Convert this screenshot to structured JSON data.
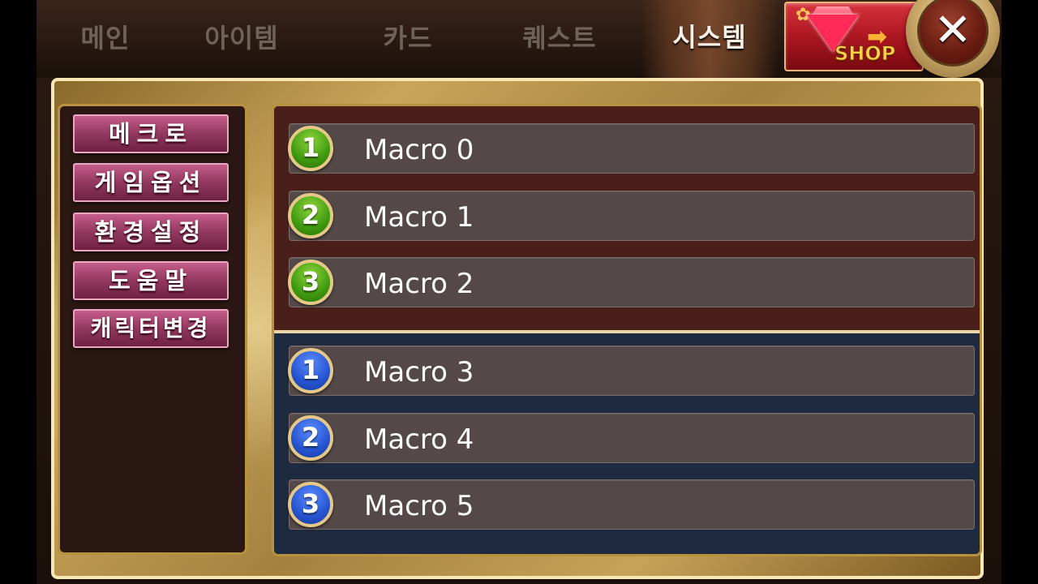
{
  "tabs": [
    {
      "label": "메인",
      "active": false
    },
    {
      "label": "아이템",
      "active": false
    },
    {
      "label": "카드",
      "active": false
    },
    {
      "label": "퀘스트",
      "active": false
    },
    {
      "label": "시스템",
      "active": true
    }
  ],
  "shop": {
    "label": "SHOP",
    "icon": "gem-icon"
  },
  "close": {
    "label": "✕",
    "icon": "close-icon"
  },
  "sidebar": {
    "items": [
      {
        "label": "메크로"
      },
      {
        "label": "게임옵션"
      },
      {
        "label": "환경설정"
      },
      {
        "label": "도움말"
      },
      {
        "label": "캐릭터변경"
      }
    ]
  },
  "macros": {
    "group1": [
      {
        "badge": "1",
        "label": "Macro 0"
      },
      {
        "badge": "2",
        "label": "Macro 1"
      },
      {
        "badge": "3",
        "label": "Macro 2"
      }
    ],
    "group2": [
      {
        "badge": "1",
        "label": "Macro 3"
      },
      {
        "badge": "2",
        "label": "Macro 4"
      },
      {
        "badge": "3",
        "label": "Macro 5"
      }
    ]
  },
  "colors": {
    "group1_bg": "#4a1f1a",
    "group2_bg": "#1e2a3f",
    "badge_green": "#3f9a10",
    "badge_blue": "#2653d0",
    "menu_button": "#93385f",
    "panel_gold": "#c9a45a"
  }
}
